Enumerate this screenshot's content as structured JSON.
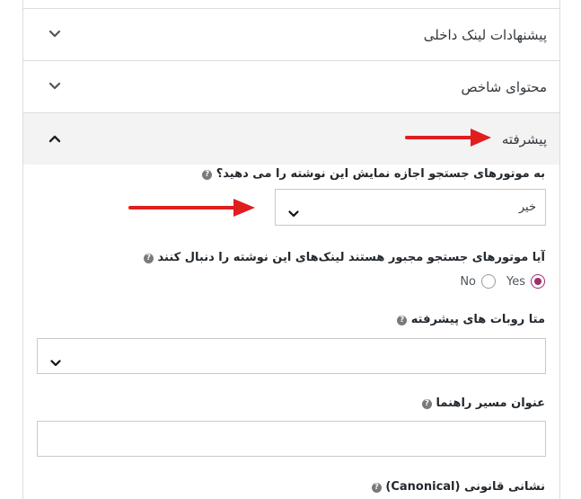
{
  "sections": [
    {
      "title": "پیشنهادات لینک داخلی",
      "state": "collapsed",
      "icon": "chevron-down-icon"
    },
    {
      "title": "محتوای شاخص",
      "state": "collapsed",
      "icon": "chevron-down-icon"
    },
    {
      "title": "پیشرفته",
      "state": "expanded",
      "icon": "chevron-up-icon"
    }
  ],
  "advanced": {
    "allow_search_label": "به موتورهای جستجو اجازه نمایش این نوشته را می دهید؟",
    "allow_search_value": "خیر",
    "follow_links_label": "آیا موتورهای جستجو مجبور هستند لینک‌های این نوشته را دنبال کنند",
    "follow_links_options": [
      {
        "label": "Yes",
        "checked": true
      },
      {
        "label": "No",
        "checked": false
      }
    ],
    "meta_robots_label": "متا روبات های پیشرفته",
    "meta_robots_value": "",
    "breadcrumb_title_label": "عنوان مسیر راهنما",
    "breadcrumb_title_value": "",
    "canonical_label": "نشانی قانونی (Canonical)"
  },
  "help_icon": "?",
  "colors": {
    "accent_radio": "#9b2f6b",
    "annotation_arrow": "#e01e1e",
    "header_open_bg": "#f3f3f4"
  }
}
